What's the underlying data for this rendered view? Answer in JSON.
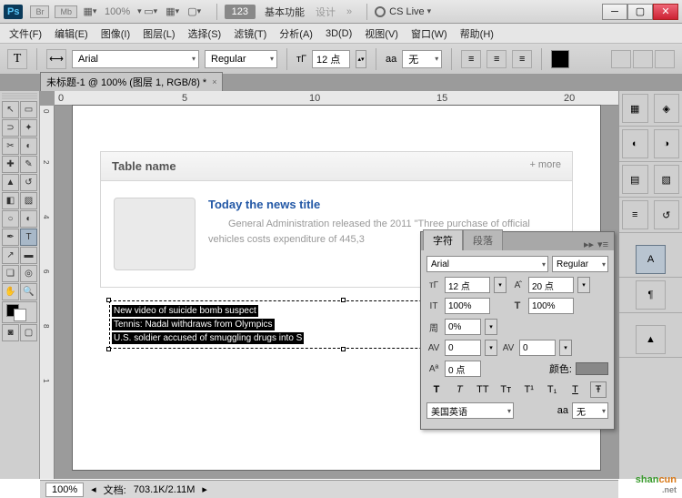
{
  "titlebar": {
    "ps": "Ps",
    "br": "Br",
    "mb": "Mb",
    "pct": "100%",
    "pill": "123",
    "w1": "基本功能",
    "w2": "设计",
    "cslive": "CS Live"
  },
  "menu": {
    "file": "文件(F)",
    "edit": "编辑(E)",
    "image": "图像(I)",
    "layer": "图层(L)",
    "select": "选择(S)",
    "filter": "滤镜(T)",
    "analysis": "分析(A)",
    "threed": "3D(D)",
    "view": "视图(V)",
    "window": "窗口(W)",
    "help": "帮助(H)"
  },
  "optbar": {
    "tool": "T",
    "font": "Arial",
    "weight": "Regular",
    "size": "12 点",
    "aa_lbl": "aa",
    "aa": "无"
  },
  "tab": {
    "title": "未标题-1 @ 100% (图层 1, RGB/8) *"
  },
  "ruler": {
    "h": [
      "0",
      "5",
      "10",
      "15",
      "20"
    ],
    "v": [
      "0",
      "2",
      "4",
      "6",
      "8",
      "1"
    ]
  },
  "card": {
    "title": "Table name",
    "more": "+ more",
    "news_title": "Today the news title",
    "news_desc": "General Administration released the 2011 \"Three purchase of official vehicles costs expenditure of 445,3"
  },
  "sel": {
    "l1": "New video of suicide bomb suspect",
    "l2": "Tennis: Nadal withdraws from Olympics",
    "l3": "U.S. soldier accused of smuggling drugs into S"
  },
  "char": {
    "tab1": "字符",
    "tab2": "段落",
    "font": "Arial",
    "weight": "Regular",
    "size": "12 点",
    "leading": "20 点",
    "vscale": "100%",
    "hscale": "100%",
    "tracking": "0%",
    "kerning": "0",
    "kern2": "0",
    "baseline": "0 点",
    "color_lbl": "颜色:",
    "lang": "美国英语",
    "aa_lbl": "aa",
    "aa": "无",
    "T": "T"
  },
  "status": {
    "zoom": "100%",
    "doc_lbl": "文档:",
    "doc": "703.1K/2.11M"
  },
  "wm": {
    "a": "shan",
    "b": "cun",
    "net": ".net"
  }
}
